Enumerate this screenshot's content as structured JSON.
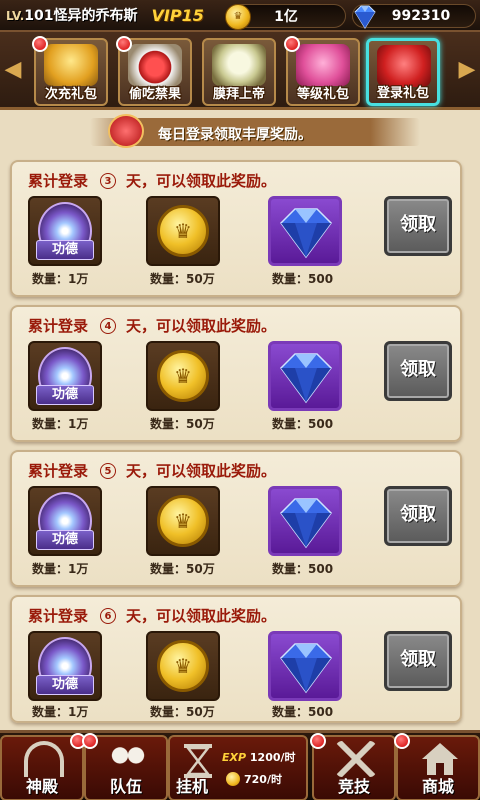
{
  "topbar": {
    "level_prefix": "LV.",
    "level": "101",
    "player_name": "怪异的乔布斯",
    "vip": "VIP15",
    "gold": "1亿",
    "gems": "992310"
  },
  "tabs": [
    {
      "label": "次充礼包",
      "has_badge": true,
      "active": false,
      "icon": "gift-box-icon"
    },
    {
      "label": "偷吃禁果",
      "has_badge": true,
      "active": false,
      "icon": "winged-apple-icon"
    },
    {
      "label": "膜拜上帝",
      "has_badge": false,
      "active": false,
      "icon": "god-face-icon"
    },
    {
      "label": "等级礼包",
      "has_badge": true,
      "active": false,
      "icon": "level-gift-icon"
    },
    {
      "label": "登录礼包",
      "has_badge": false,
      "active": true,
      "icon": "login-gift-icon"
    }
  ],
  "banner": {
    "text": "每日登录领取丰厚奖励。"
  },
  "rewards": [
    {
      "title_prefix": "累计登录",
      "days": "3",
      "title_suffix": "天，可以领取此奖励。",
      "merit_label": "功德",
      "merit_qty": "数量：1万",
      "coin_qty": "数量：50万",
      "gem_qty": "数量：500",
      "claim_label": "领取"
    },
    {
      "title_prefix": "累计登录",
      "days": "4",
      "title_suffix": "天，可以领取此奖励。",
      "merit_label": "功德",
      "merit_qty": "数量：1万",
      "coin_qty": "数量：50万",
      "gem_qty": "数量：500",
      "claim_label": "领取"
    },
    {
      "title_prefix": "累计登录",
      "days": "5",
      "title_suffix": "天，可以领取此奖励。",
      "merit_label": "功德",
      "merit_qty": "数量：1万",
      "coin_qty": "数量：50万",
      "gem_qty": "数量：500",
      "claim_label": "领取"
    },
    {
      "title_prefix": "累计登录",
      "days": "6",
      "title_suffix": "天，可以领取此奖励。",
      "merit_label": "功德",
      "merit_qty": "数量：1万",
      "coin_qty": "数量：50万",
      "gem_qty": "数量：500",
      "claim_label": "领取"
    }
  ],
  "bottom_nav": {
    "temple": "神殿",
    "team": "队伍",
    "idle": "挂机",
    "exp_label": "EXP",
    "exp_rate": "1200/时",
    "gold_rate": "720/时",
    "arena": "竞技",
    "shop": "商城"
  },
  "colors": {
    "title_red": "#9a1a0a",
    "active_tab": "#48e0e0",
    "vip_gold": "#ffd23a"
  }
}
